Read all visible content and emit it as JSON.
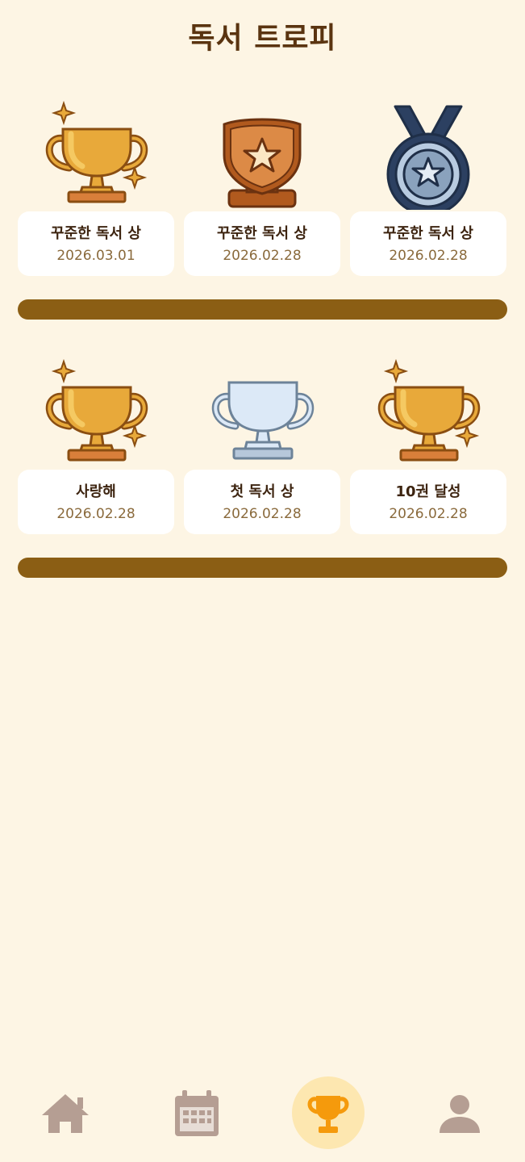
{
  "page": {
    "title": "독서 트로피"
  },
  "colors": {
    "background": "#fdf5e4",
    "title": "#5a3410",
    "shelf": "#8b5e14",
    "card": "#ffffff",
    "date_text": "#8a6a3c",
    "nav_inactive": "#b59e93",
    "nav_active": "#f59a0c",
    "nav_active_bg": "#fde7b0"
  },
  "trophies": [
    {
      "name": "꾸준한 독서 상",
      "date": "2026.03.01",
      "icon": "gold-trophy-icon"
    },
    {
      "name": "꾸준한 독서 상",
      "date": "2026.02.28",
      "icon": "bronze-shield-icon"
    },
    {
      "name": "꾸준한 독서 상",
      "date": "2026.02.28",
      "icon": "silver-medal-icon"
    },
    {
      "name": "사랑해",
      "date": "2026.02.28",
      "icon": "gold-trophy-icon"
    },
    {
      "name": "첫 독서 상",
      "date": "2026.02.28",
      "icon": "silver-trophy-icon"
    },
    {
      "name": "10권 달성",
      "date": "2026.02.28",
      "icon": "gold-trophy-icon"
    }
  ],
  "nav": {
    "items": [
      {
        "icon": "home-icon",
        "active": false
      },
      {
        "icon": "calendar-icon",
        "active": false
      },
      {
        "icon": "trophy-icon",
        "active": true
      },
      {
        "icon": "profile-icon",
        "active": false
      }
    ]
  }
}
